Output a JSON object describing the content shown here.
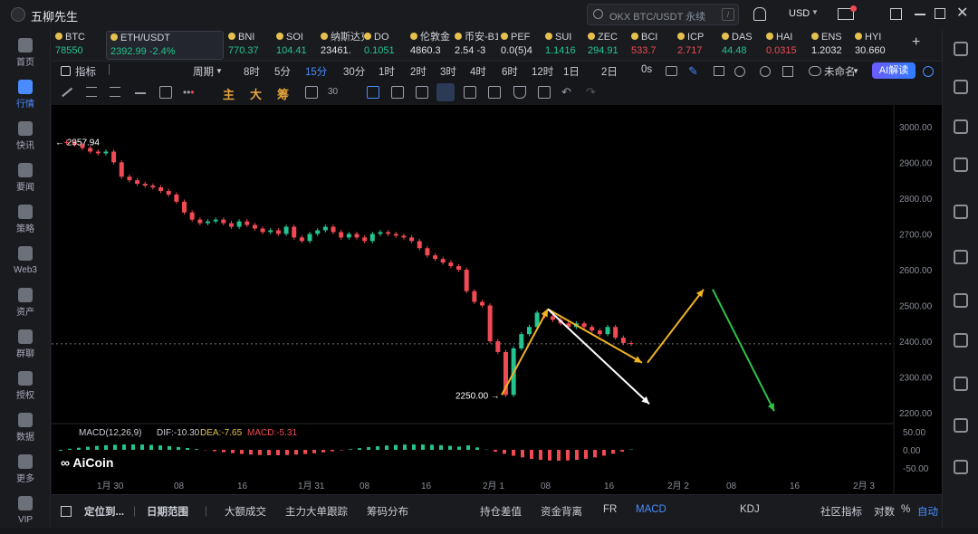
{
  "app": {
    "title": "五柳先生"
  },
  "search": {
    "placeholder": "OKX BTC/USDT 永续",
    "key": "/"
  },
  "currency": "USD",
  "sidebar": [
    {
      "label": "首页"
    },
    {
      "label": "行情"
    },
    {
      "label": "快讯"
    },
    {
      "label": "要闻"
    },
    {
      "label": "策略"
    },
    {
      "label": "Web3"
    },
    {
      "label": "资产"
    },
    {
      "label": "群聊"
    },
    {
      "label": "授权"
    },
    {
      "label": "数据"
    },
    {
      "label": "更多"
    },
    {
      "label": "VIP"
    }
  ],
  "tickers": [
    {
      "name": "BTC",
      "value": "78550",
      "dir": "up"
    },
    {
      "name": "ETH/USDT",
      "value": "2392.99 -2.4%",
      "dir": "up"
    },
    {
      "name": "BNI",
      "value": "770.37",
      "dir": "up"
    },
    {
      "name": "SOI",
      "value": "104.41",
      "dir": "up"
    },
    {
      "name": "纳斯达克",
      "value": "23461.",
      "dir": "neu"
    },
    {
      "name": "DO",
      "value": "0.1051",
      "dir": "up"
    },
    {
      "name": "伦敦金",
      "value": "4860.3",
      "dir": "neu"
    },
    {
      "name": "币安-B1",
      "value": "2.54 -3",
      "dir": "neu"
    },
    {
      "name": "PEF",
      "value": "0.0(5)4",
      "dir": "neu"
    },
    {
      "name": "SUI",
      "value": "1.1416",
      "dir": "up"
    },
    {
      "name": "ZEC",
      "value": "294.91",
      "dir": "up"
    },
    {
      "name": "BCI",
      "value": "533.7",
      "dir": "dn"
    },
    {
      "name": "ICP",
      "value": "2.717",
      "dir": "dn"
    },
    {
      "name": "DAS",
      "value": "44.48",
      "dir": "up"
    },
    {
      "name": "HAI",
      "value": "0.0315",
      "dir": "dn"
    },
    {
      "name": "ENS",
      "value": "1.2032",
      "dir": "neu"
    },
    {
      "name": "HYI",
      "value": "30.660",
      "dir": "neu"
    }
  ],
  "toolbar": {
    "indicator": "指标",
    "period": "周期",
    "intervals": [
      "8时",
      "5分",
      "15分",
      "30分",
      "1时",
      "2时",
      "3时",
      "4时",
      "6时",
      "12时",
      "1日",
      "2日"
    ],
    "active_interval": "15分",
    "zero": "0s",
    "template": "未命名",
    "ai": "AI解读"
  },
  "draw_tools": {
    "main": "主",
    "big": "大",
    "chips": "筹"
  },
  "chart_data": {
    "type": "line",
    "symbol": "ETH/USDT 15m",
    "high_label": "2957.94",
    "low_label": "2250.00",
    "current_price": 2392.99,
    "y_ticks": [
      "3000.00",
      "2900.00",
      "2800.00",
      "2700.00",
      "2600.00",
      "2500.00",
      "2400.00",
      "2300.00",
      "2200.00"
    ],
    "ylim": [
      2170,
      3040
    ],
    "x_ticks": [
      "1月 30",
      "08",
      "16",
      "1月 31",
      "08",
      "16",
      "2月 1",
      "08",
      "16",
      "2月 2",
      "08",
      "16",
      "2月 3"
    ],
    "price_path": [
      2957,
      2955,
      2950,
      2940,
      2930,
      2925,
      2930,
      2900,
      2860,
      2850,
      2840,
      2835,
      2830,
      2820,
      2810,
      2790,
      2760,
      2740,
      2730,
      2735,
      2740,
      2730,
      2720,
      2735,
      2725,
      2715,
      2705,
      2710,
      2700,
      2720,
      2690,
      2680,
      2700,
      2710,
      2720,
      2705,
      2690,
      2700,
      2690,
      2680,
      2700,
      2705,
      2700,
      2695,
      2690,
      2680,
      2660,
      2640,
      2630,
      2620,
      2610,
      2600,
      2540,
      2510,
      2500,
      2400,
      2370,
      2250,
      2380,
      2420,
      2440,
      2480,
      2470,
      2460,
      2450,
      2440,
      2450,
      2440,
      2430,
      2420,
      2440,
      2410,
      2395,
      2393
    ],
    "arrows": [
      {
        "from": [
          2250,
          0
        ],
        "to": [
          2490,
          1
        ],
        "color": "#f0b323"
      },
      {
        "from": [
          2490,
          1
        ],
        "to": [
          2340,
          2
        ],
        "color": "#f0b323"
      },
      {
        "from": [
          2490,
          1
        ],
        "to": [
          2225,
          3
        ],
        "color": "#ffffff"
      },
      {
        "from": [
          2340,
          4
        ],
        "to": [
          2545,
          5
        ],
        "color": "#f0b323"
      },
      {
        "from": [
          2545,
          6
        ],
        "to": [
          2205,
          7
        ],
        "color": "#2dc44a"
      }
    ],
    "macd": {
      "label": "MACD(12,26,9)",
      "dif": "DIF:-10.30",
      "dea": "DEA:-7.65",
      "macd": "MACD:-5.31",
      "y_ticks": [
        "50.00",
        "0.00",
        "-50.00"
      ]
    },
    "watermark": "AiCoin"
  },
  "bottom": {
    "locate": "定位到...",
    "range": "日期范围",
    "items": [
      "大额成交",
      "主力大单跟踪",
      "筹码分布",
      "持仓差值",
      "资金背离",
      "FR",
      "MACD",
      "KDJ"
    ],
    "active": "MACD",
    "community": "社区指标",
    "log": "对数",
    "pct": "%",
    "auto": "自动"
  }
}
